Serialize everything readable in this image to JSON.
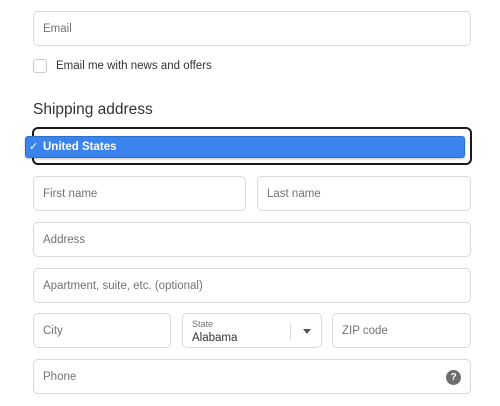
{
  "contact": {
    "email_placeholder": "Email",
    "newsletter_label": "Email me with news and offers"
  },
  "shipping": {
    "title": "Shipping address",
    "country": {
      "selected": "United States",
      "check_glyph": "✓"
    },
    "first_name_placeholder": "First name",
    "last_name_placeholder": "Last name",
    "address_placeholder": "Address",
    "apartment_placeholder": "Apartment, suite, etc. (optional)",
    "city_placeholder": "City",
    "state": {
      "label": "State",
      "value": "Alabama"
    },
    "zip_placeholder": "ZIP code",
    "phone_placeholder": "Phone",
    "help_glyph": "?"
  },
  "icons": {
    "check": "check-icon",
    "state_dropdown": "chevron-down-icon",
    "phone_help": "help-icon"
  },
  "colors": {
    "selected_option_bg": "#3b84ee",
    "field_border": "#d9d9d9",
    "focus_border": "#1a1a1a",
    "placeholder_text": "#737373"
  }
}
